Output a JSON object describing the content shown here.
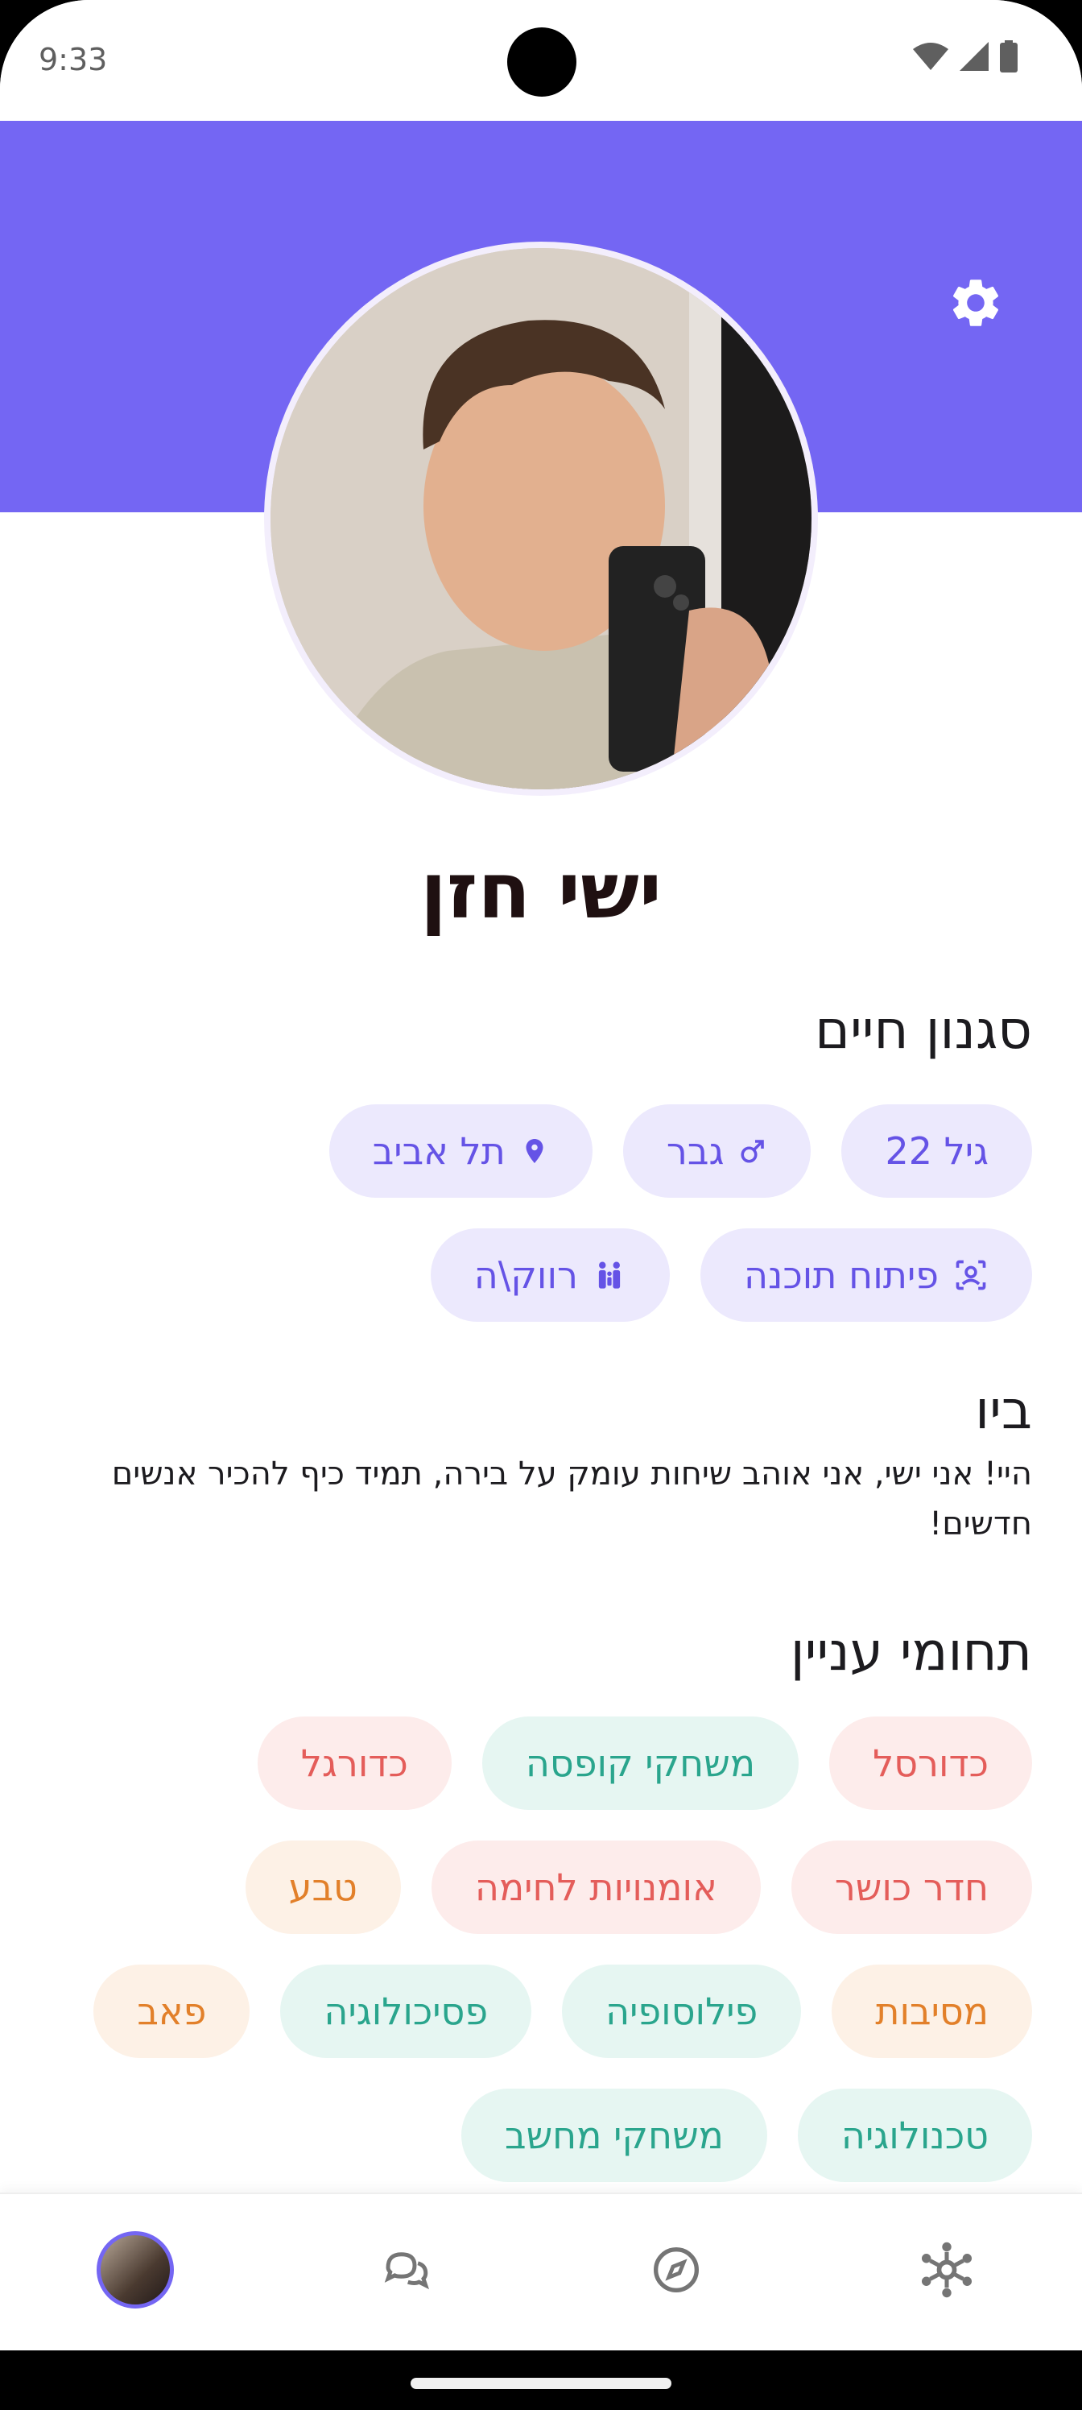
{
  "status_bar": {
    "time": "9:33"
  },
  "profile": {
    "name": "ישי חזן"
  },
  "lifestyle": {
    "title": "סגנון חיים",
    "chips": [
      {
        "label": "גיל 22",
        "icon": "none"
      },
      {
        "label": "גבר",
        "icon": "male-icon"
      },
      {
        "label": "תל אביב",
        "icon": "location-pin-icon"
      },
      {
        "label": "פיתוח תוכנה",
        "icon": "work-icon"
      },
      {
        "label": "רווק\\ה",
        "icon": "people-icon"
      }
    ]
  },
  "bio": {
    "title": "ביו",
    "text": "היי! אני ישי, אני אוהב שיחות עומק על בירה, תמיד כיף להכיר אנשים חדשים!"
  },
  "interests": {
    "title": "תחומי עניין",
    "chips": [
      {
        "label": "כדורסל",
        "color": "red"
      },
      {
        "label": "משחקי קופסה",
        "color": "green"
      },
      {
        "label": "כדורגל",
        "color": "red"
      },
      {
        "label": "חדר כושר",
        "color": "red"
      },
      {
        "label": "אומנויות לחימה",
        "color": "red"
      },
      {
        "label": "טבע",
        "color": "orange"
      },
      {
        "label": "מסיבות",
        "color": "orange"
      },
      {
        "label": "פילוסופיה",
        "color": "green"
      },
      {
        "label": "פסיכולוגיה",
        "color": "green"
      },
      {
        "label": "פאב",
        "color": "orange"
      },
      {
        "label": "טכנולוגיה",
        "color": "green"
      },
      {
        "label": "משחקי מחשב",
        "color": "green"
      }
    ]
  },
  "bottom_nav": {
    "items": [
      "profile-avatar",
      "chat-icon",
      "explore-compass-icon",
      "network-icon"
    ]
  },
  "colors": {
    "header": "#7466f3",
    "purple_chip_bg": "#ece9fd",
    "purple_chip_fg": "#6553e6",
    "red_chip_bg": "#fdeceb",
    "red_chip_fg": "#e45d5a",
    "green_chip_bg": "#e6f6f2",
    "green_chip_fg": "#2aa58d",
    "orange_chip_bg": "#fdf1e6",
    "orange_chip_fg": "#e2802a"
  }
}
